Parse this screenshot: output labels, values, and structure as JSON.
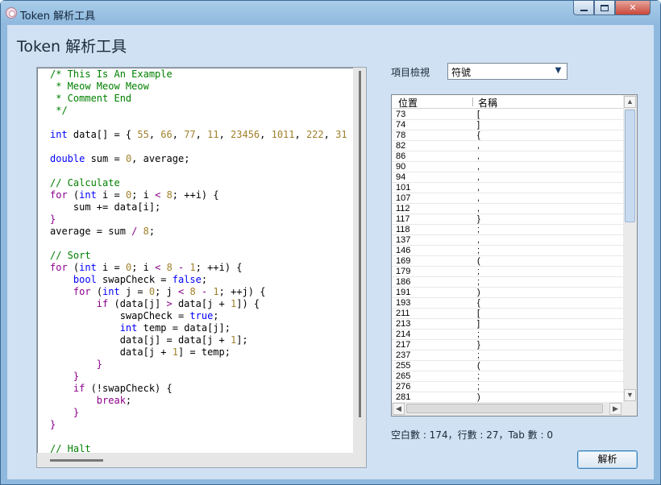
{
  "window": {
    "title": "Token 解析工具",
    "min_glyph": "",
    "close_glyph": "✕"
  },
  "page_title": "Token 解析工具",
  "code": {
    "lines": [
      [
        [
          "comment",
          "/* This Is An Example"
        ]
      ],
      [
        [
          "comment",
          " * Meow Meow Meow"
        ]
      ],
      [
        [
          "comment",
          " * Comment End"
        ]
      ],
      [
        [
          "comment",
          " */"
        ]
      ],
      [],
      [
        [
          "keyword",
          "int"
        ],
        [
          "plain",
          " data[] = { "
        ],
        [
          "number",
          "55"
        ],
        [
          "plain",
          ", "
        ],
        [
          "number",
          "66"
        ],
        [
          "plain",
          ", "
        ],
        [
          "number",
          "77"
        ],
        [
          "plain",
          ", "
        ],
        [
          "number",
          "11"
        ],
        [
          "plain",
          ", "
        ],
        [
          "number",
          "23456"
        ],
        [
          "plain",
          ", "
        ],
        [
          "number",
          "1011"
        ],
        [
          "plain",
          ", "
        ],
        [
          "number",
          "222"
        ],
        [
          "plain",
          ", "
        ],
        [
          "number",
          "31"
        ],
        [
          "plain",
          " }"
        ]
      ],
      [],
      [
        [
          "keyword",
          "double"
        ],
        [
          "plain",
          " sum = "
        ],
        [
          "number",
          "0"
        ],
        [
          "plain",
          ", average;"
        ]
      ],
      [],
      [
        [
          "comment",
          "// Calculate"
        ]
      ],
      [
        [
          "control",
          "for"
        ],
        [
          "plain",
          " ("
        ],
        [
          "keyword",
          "int"
        ],
        [
          "plain",
          " i = "
        ],
        [
          "number",
          "0"
        ],
        [
          "plain",
          "; i "
        ],
        [
          "op",
          "<"
        ],
        [
          "plain",
          " "
        ],
        [
          "number",
          "8"
        ],
        [
          "plain",
          "; ++i) {"
        ]
      ],
      [
        [
          "plain",
          "    sum += data[i];"
        ]
      ],
      [
        [
          "op",
          "}"
        ]
      ],
      [
        [
          "plain",
          "average = sum "
        ],
        [
          "op",
          "/"
        ],
        [
          "plain",
          " "
        ],
        [
          "number",
          "8"
        ],
        [
          "plain",
          ";"
        ]
      ],
      [],
      [
        [
          "comment",
          "// Sort"
        ]
      ],
      [
        [
          "control",
          "for"
        ],
        [
          "plain",
          " ("
        ],
        [
          "keyword",
          "int"
        ],
        [
          "plain",
          " i = "
        ],
        [
          "number",
          "0"
        ],
        [
          "plain",
          "; i "
        ],
        [
          "op",
          "<"
        ],
        [
          "plain",
          " "
        ],
        [
          "number",
          "8"
        ],
        [
          "plain",
          " "
        ],
        [
          "op",
          "-"
        ],
        [
          "plain",
          " "
        ],
        [
          "number",
          "1"
        ],
        [
          "plain",
          "; ++i) {"
        ]
      ],
      [
        [
          "plain",
          "    "
        ],
        [
          "keyword",
          "bool"
        ],
        [
          "plain",
          " swapCheck = "
        ],
        [
          "keyword",
          "false"
        ],
        [
          "plain",
          ";"
        ]
      ],
      [
        [
          "plain",
          "    "
        ],
        [
          "control",
          "for"
        ],
        [
          "plain",
          " ("
        ],
        [
          "keyword",
          "int"
        ],
        [
          "plain",
          " j = "
        ],
        [
          "number",
          "0"
        ],
        [
          "plain",
          "; j "
        ],
        [
          "op",
          "<"
        ],
        [
          "plain",
          " "
        ],
        [
          "number",
          "8"
        ],
        [
          "plain",
          " "
        ],
        [
          "op",
          "-"
        ],
        [
          "plain",
          " "
        ],
        [
          "number",
          "1"
        ],
        [
          "plain",
          "; ++j) {"
        ]
      ],
      [
        [
          "plain",
          "        "
        ],
        [
          "control",
          "if"
        ],
        [
          "plain",
          " (data[j] "
        ],
        [
          "op",
          ">"
        ],
        [
          "plain",
          " data[j + "
        ],
        [
          "number",
          "1"
        ],
        [
          "plain",
          "]) {"
        ]
      ],
      [
        [
          "plain",
          "            swapCheck = "
        ],
        [
          "keyword",
          "true"
        ],
        [
          "plain",
          ";"
        ]
      ],
      [
        [
          "plain",
          "            "
        ],
        [
          "keyword",
          "int"
        ],
        [
          "plain",
          " temp = data[j];"
        ]
      ],
      [
        [
          "plain",
          "            data[j] = data[j + "
        ],
        [
          "number",
          "1"
        ],
        [
          "plain",
          "];"
        ]
      ],
      [
        [
          "plain",
          "            data[j + "
        ],
        [
          "number",
          "1"
        ],
        [
          "plain",
          "] = temp;"
        ]
      ],
      [
        [
          "plain",
          "        "
        ],
        [
          "op",
          "}"
        ]
      ],
      [
        [
          "plain",
          "    "
        ],
        [
          "op",
          "}"
        ]
      ],
      [
        [
          "plain",
          "    "
        ],
        [
          "control",
          "if"
        ],
        [
          "plain",
          " (!swapCheck) {"
        ]
      ],
      [
        [
          "plain",
          "        "
        ],
        [
          "control",
          "break"
        ],
        [
          "plain",
          ";"
        ]
      ],
      [
        [
          "plain",
          "    "
        ],
        [
          "op",
          "}"
        ]
      ],
      [
        [
          "op",
          "}"
        ]
      ],
      [],
      [
        [
          "comment",
          "// Halt"
        ]
      ]
    ]
  },
  "view": {
    "label": "項目檢視",
    "selected": "符號",
    "arrow_glyph": "▼"
  },
  "token_list": {
    "columns": [
      "位置",
      "名稱"
    ],
    "rows": [
      [
        "73",
        "["
      ],
      [
        "74",
        "]"
      ],
      [
        "78",
        "{"
      ],
      [
        "82",
        ","
      ],
      [
        "86",
        ","
      ],
      [
        "90",
        ","
      ],
      [
        "94",
        ","
      ],
      [
        "101",
        ","
      ],
      [
        "107",
        ","
      ],
      [
        "112",
        ","
      ],
      [
        "117",
        "}"
      ],
      [
        "118",
        ";"
      ],
      [
        "137",
        ","
      ],
      [
        "146",
        ";"
      ],
      [
        "169",
        "("
      ],
      [
        "179",
        ";"
      ],
      [
        "186",
        ";"
      ],
      [
        "191",
        ")"
      ],
      [
        "193",
        "{"
      ],
      [
        "211",
        "["
      ],
      [
        "213",
        "]"
      ],
      [
        "214",
        ";"
      ],
      [
        "217",
        "}"
      ],
      [
        "237",
        ";"
      ],
      [
        "255",
        "("
      ],
      [
        "265",
        ";"
      ],
      [
        "276",
        ";"
      ],
      [
        "281",
        ")"
      ]
    ],
    "scroll_up": "▲",
    "scroll_down": "▼",
    "scroll_left": "◀",
    "scroll_right": "▶"
  },
  "stats": "空白數 : 174，行數 : 27，Tab 數 : 0",
  "parse_button": "解析"
}
